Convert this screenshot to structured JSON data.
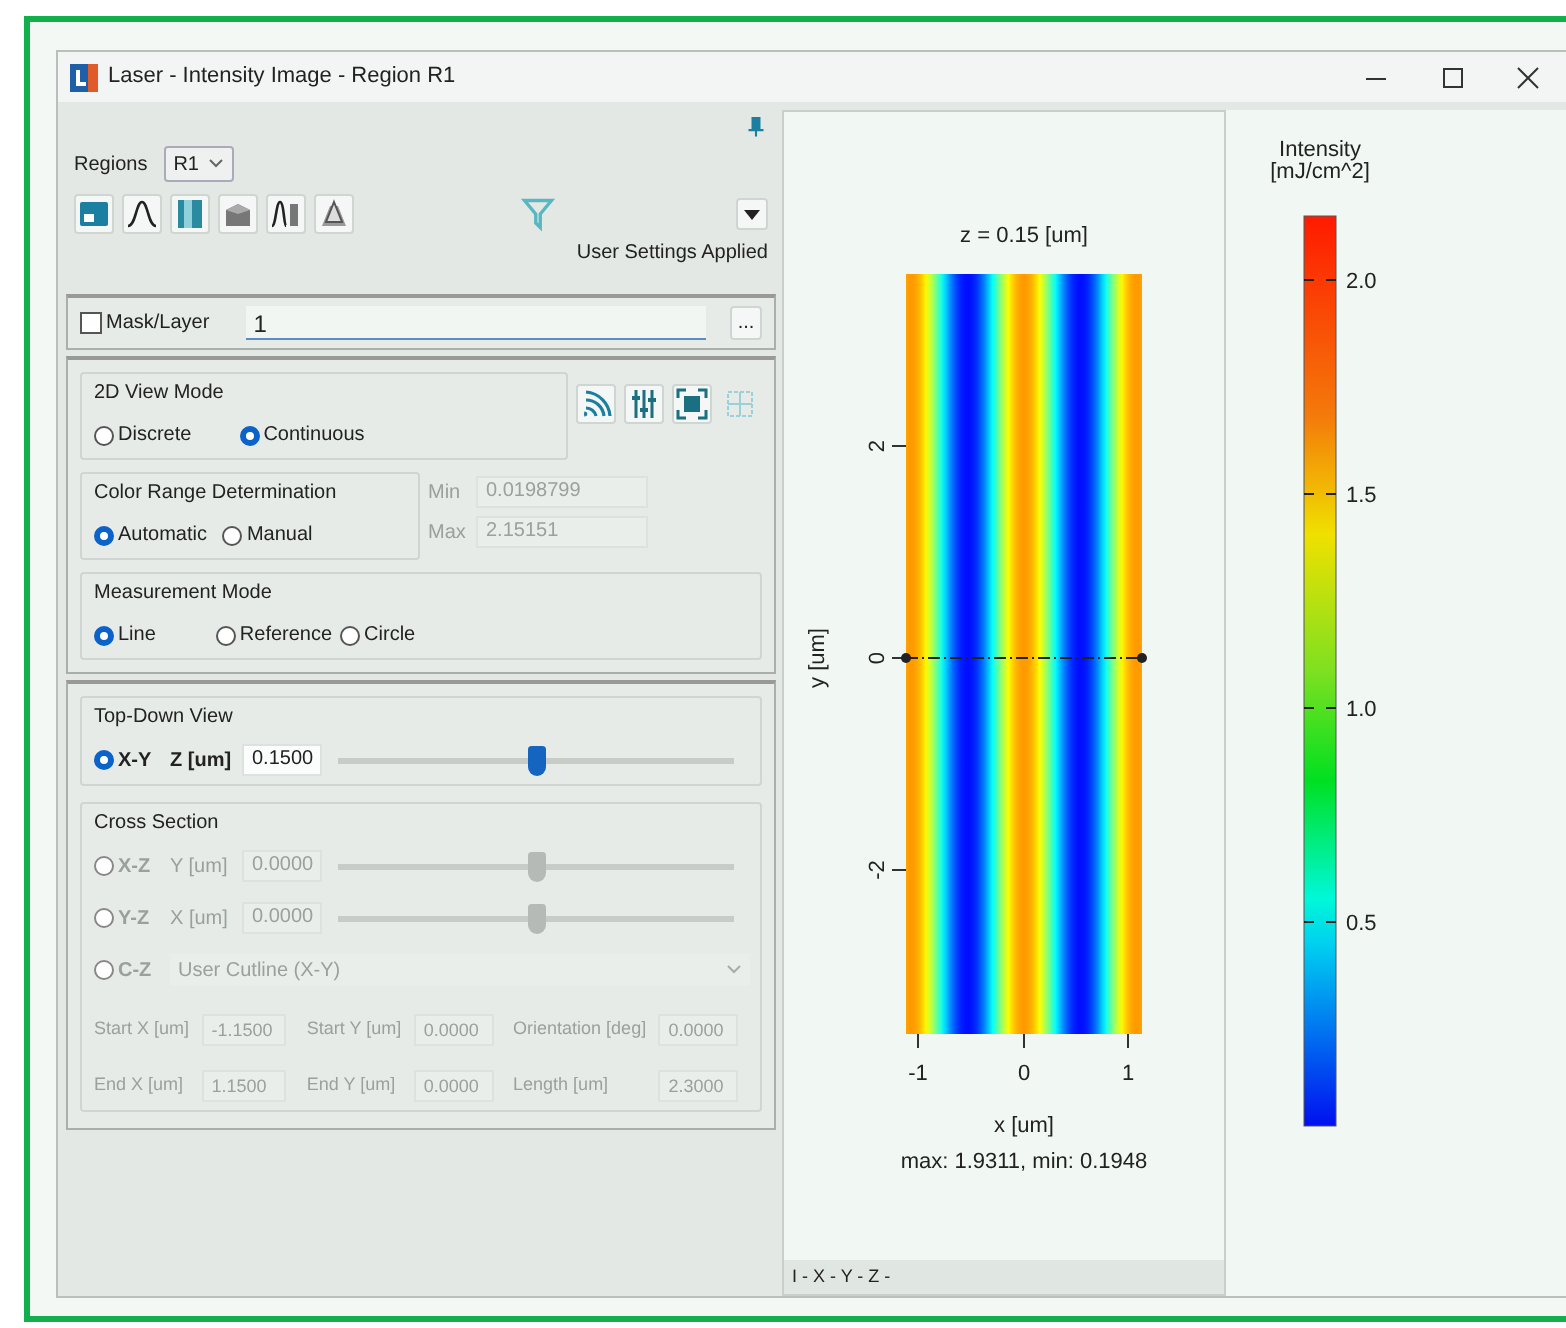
{
  "window": {
    "title": "Laser - Intensity Image - Region R1"
  },
  "regions": {
    "label": "Regions",
    "value": "R1"
  },
  "toolbar_status": "User Settings Applied",
  "mask_layer": {
    "label": "Mask/Layer",
    "checked": false,
    "value": "1",
    "button": "..."
  },
  "view_mode": {
    "title": "2D View Mode",
    "options": [
      {
        "label": "Discrete",
        "selected": false
      },
      {
        "label": "Continuous",
        "selected": true
      }
    ]
  },
  "color_range": {
    "title": "Color Range Determination",
    "options": [
      {
        "label": "Automatic",
        "selected": true
      },
      {
        "label": "Manual",
        "selected": false
      }
    ],
    "fields": [
      {
        "label": "Min",
        "value": "0.0198799"
      },
      {
        "label": "Max",
        "value": "2.15151"
      }
    ]
  },
  "measurement_mode": {
    "title": "Measurement Mode",
    "options": [
      {
        "label": "Line",
        "selected": true
      },
      {
        "label": "Reference",
        "selected": false
      },
      {
        "label": "Circle",
        "selected": false
      }
    ]
  },
  "top_down": {
    "title": "Top-Down View",
    "label": "X-Y",
    "selected": true,
    "field_label": "Z [um]",
    "value": "0.1500",
    "level": 0.5
  },
  "cross_section": {
    "title": "Cross Section",
    "disabled": true,
    "rows": [
      {
        "kind": "slider",
        "label": "X-Z",
        "selected": false,
        "field_label": "Y [um]",
        "value": "0.0000",
        "level": 0.5
      },
      {
        "kind": "slider",
        "label": "Y-Z",
        "selected": false,
        "field_label": "X [um]",
        "value": "0.0000",
        "level": 0.5
      },
      {
        "kind": "dropdown",
        "label": "C-Z",
        "selected": false,
        "value": "User Cutline (X-Y)"
      }
    ],
    "fields": [
      {
        "label": "Start X [um]",
        "value": "-1.1500"
      },
      {
        "label": "Start Y [um]",
        "value": "0.0000"
      },
      {
        "label": "Orientation [deg]",
        "value": "0.0000"
      },
      {
        "label": "End X [um]",
        "value": "1.1500"
      },
      {
        "label": "End Y [um]",
        "value": "0.0000"
      },
      {
        "label": "Length [um]",
        "value": "2.3000"
      }
    ]
  },
  "plot": {
    "title": "z = 0.15 [um]",
    "ylabel": "y [um]",
    "xlabel": "x [um]",
    "x_ticks": [
      "-1",
      "0",
      "1"
    ],
    "y_ticks": [
      "2",
      "0",
      "-2"
    ],
    "summary": "max: 1.9311, min: 0.1948",
    "footer": "I - X - Y - Z -"
  },
  "colorbar": {
    "title": "Intensity",
    "unit": "[mJ/cm^2]",
    "ticks": [
      "2.0",
      "1.5",
      "1.0",
      "0.5"
    ]
  }
}
